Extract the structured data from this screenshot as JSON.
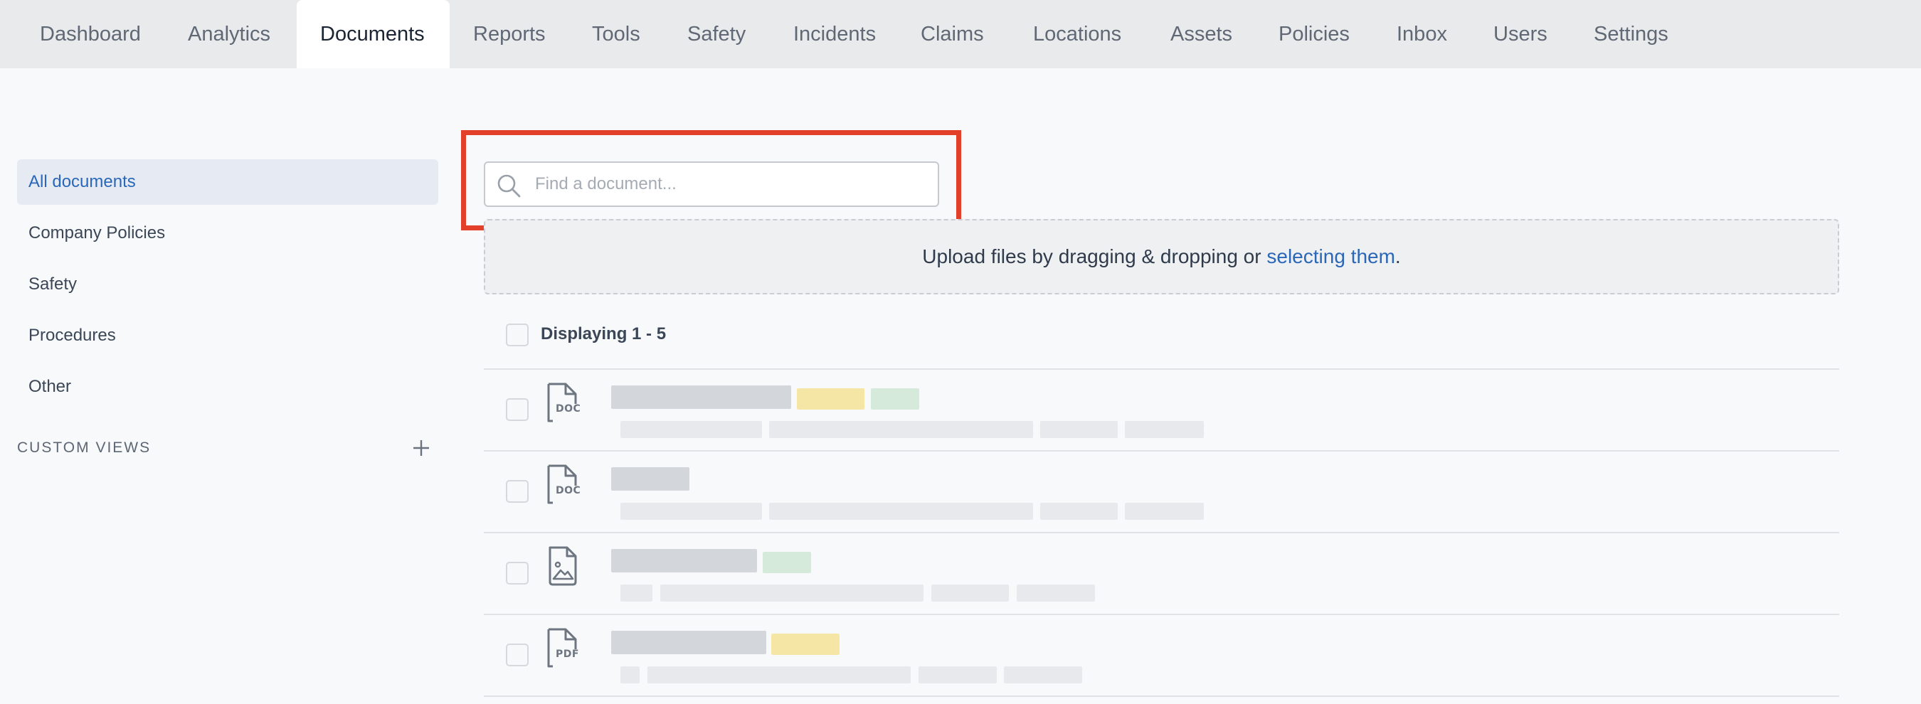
{
  "topnav": {
    "tabs": [
      {
        "label": "Dashboard",
        "key": "dashboard"
      },
      {
        "label": "Analytics",
        "key": "analytics"
      },
      {
        "label": "Documents",
        "key": "documents",
        "active": true
      },
      {
        "label": "Reports",
        "key": "reports"
      },
      {
        "label": "Tools",
        "key": "tools"
      },
      {
        "label": "Safety",
        "key": "safety"
      },
      {
        "label": "Incidents",
        "key": "incidents"
      },
      {
        "label": "Claims",
        "key": "claims"
      },
      {
        "label": "Locations",
        "key": "locations"
      },
      {
        "label": "Assets",
        "key": "assets"
      },
      {
        "label": "Policies",
        "key": "policies"
      },
      {
        "label": "Inbox",
        "key": "inbox"
      },
      {
        "label": "Users",
        "key": "users"
      },
      {
        "label": "Settings",
        "key": "settings"
      }
    ]
  },
  "sidebar": {
    "items": [
      {
        "label": "All documents",
        "active": true
      },
      {
        "label": "Company Policies"
      },
      {
        "label": "Safety"
      },
      {
        "label": "Procedures"
      },
      {
        "label": "Other"
      }
    ],
    "custom_views_label": "CUSTOM VIEWS"
  },
  "search": {
    "placeholder": "Find a document...",
    "value": ""
  },
  "upload": {
    "text_before": "Upload files by dragging & dropping or ",
    "link_text": "selecting them",
    "text_after": "."
  },
  "list": {
    "displaying_label": "Displaying 1 - 5",
    "rows": [
      {
        "file_type": "DOC",
        "icon": "doc-file-icon"
      },
      {
        "file_type": "DOC",
        "icon": "doc-file-icon"
      },
      {
        "file_type": "",
        "icon": "image-file-icon"
      },
      {
        "file_type": "PDF",
        "icon": "pdf-file-icon"
      }
    ]
  },
  "colors": {
    "accent": "#2a67b8",
    "highlight": "#e2402a",
    "tag_yellow": "#f6e6a6",
    "tag_green": "#d6eadc",
    "placeholder_bar": "#d3d6db"
  }
}
